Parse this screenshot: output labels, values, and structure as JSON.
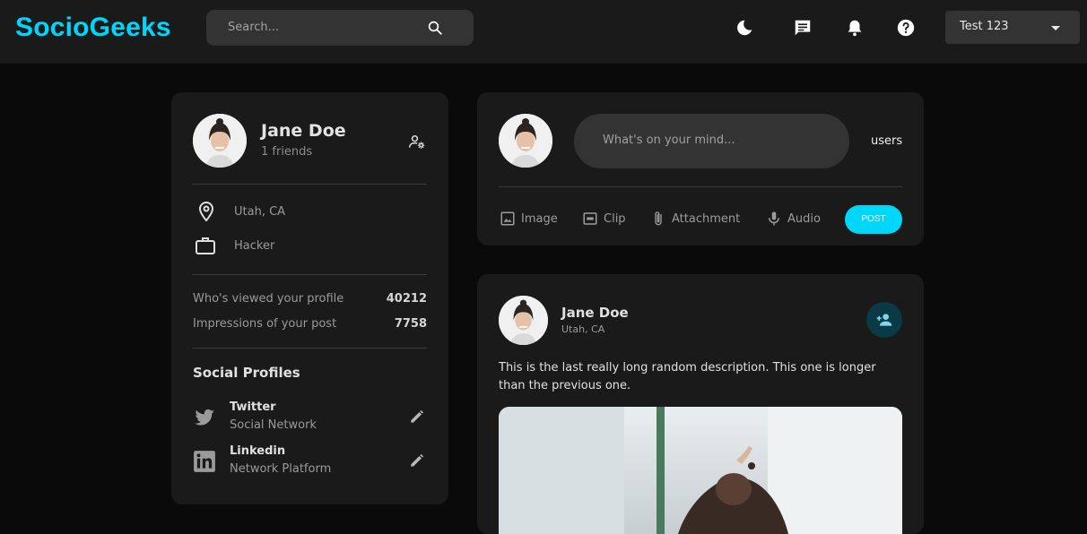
{
  "app": {
    "logo": "SocioGeeks"
  },
  "search": {
    "placeholder": "Search..."
  },
  "header": {
    "user_label": "Test 123"
  },
  "icons": {
    "search": "search-icon",
    "dark_mode": "moon-icon",
    "messages": "chat-icon",
    "notifications": "bell-icon",
    "help": "help-icon"
  },
  "colors": {
    "brand": "#00d5fa",
    "card": "#1a1a1a",
    "background": "#0a0a0a",
    "input": "#333333"
  },
  "profile": {
    "name": "Jane Doe",
    "friends": "1 friends",
    "location": "Utah, CA",
    "occupation": "Hacker",
    "stats": [
      {
        "label": "Who's viewed your profile",
        "value": "40212"
      },
      {
        "label": "Impressions of your post",
        "value": "7758"
      }
    ],
    "social_title": "Social Profiles",
    "social": [
      {
        "name": "Twitter",
        "sub": "Social Network"
      },
      {
        "name": "Linkedin",
        "sub": "Network Platform"
      }
    ]
  },
  "composer": {
    "placeholder": "What's on your mind...",
    "users_label": "users",
    "actions": [
      {
        "label": "Image",
        "icon": "image-icon"
      },
      {
        "label": "Clip",
        "icon": "gif-icon"
      },
      {
        "label": "Attachment",
        "icon": "attachment-icon"
      },
      {
        "label": "Audio",
        "icon": "mic-icon"
      }
    ],
    "post_label": "POST"
  },
  "post": {
    "author": "Jane Doe",
    "location": "Utah, CA",
    "description": "This is the last really long random description. This one is longer than the previous one."
  }
}
